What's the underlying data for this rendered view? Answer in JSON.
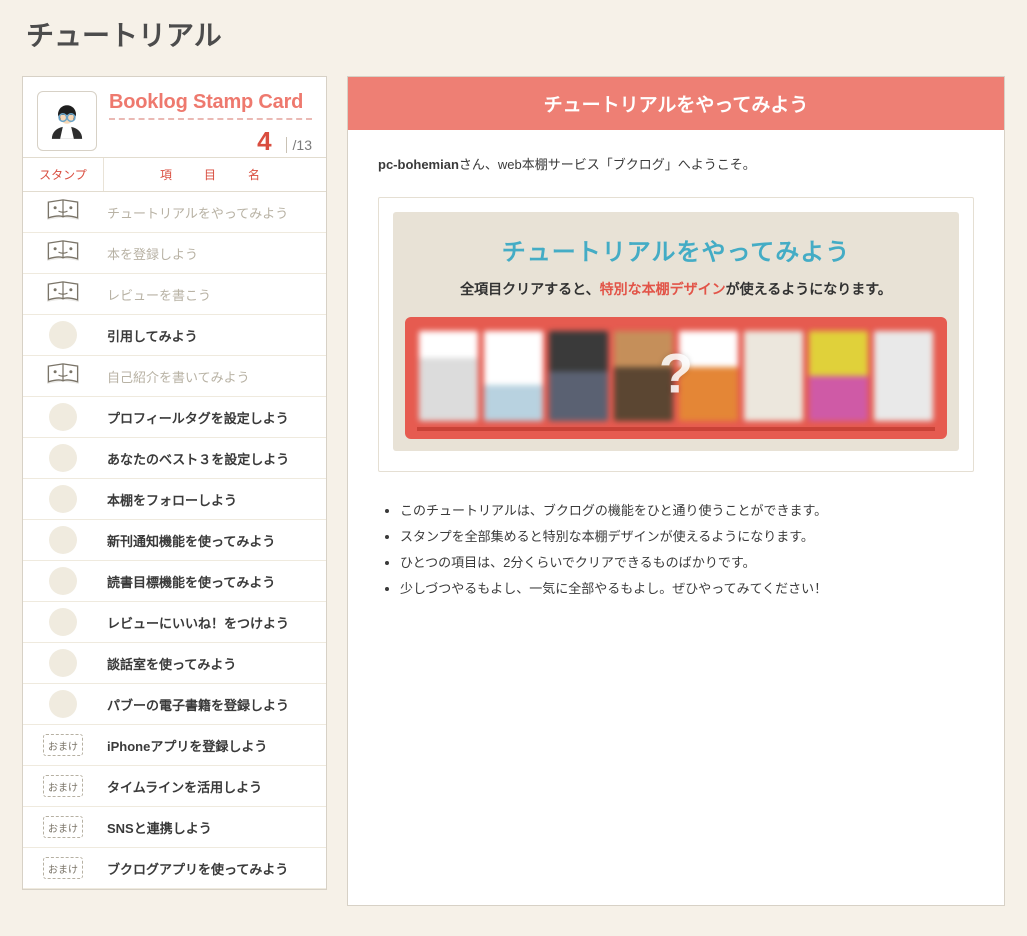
{
  "page_title": "チュートリアル",
  "card": {
    "title": "Booklog Stamp Card",
    "completed": "4",
    "total": "/13",
    "columns": {
      "stamp": "スタンプ",
      "name": "項　目　名"
    },
    "bonus_label": "おまけ",
    "items": [
      {
        "kind": "done",
        "label": "チュートリアルをやってみよう"
      },
      {
        "kind": "done",
        "label": "本を登録しよう"
      },
      {
        "kind": "done",
        "label": "レビューを書こう"
      },
      {
        "kind": "todo",
        "label": "引用してみよう"
      },
      {
        "kind": "done",
        "label": "自己紹介を書いてみよう"
      },
      {
        "kind": "todo",
        "label": "プロフィールタグを設定しよう"
      },
      {
        "kind": "todo",
        "label": "あなたのベスト３を設定しよう"
      },
      {
        "kind": "todo",
        "label": "本棚をフォローしよう"
      },
      {
        "kind": "todo",
        "label": "新刊通知機能を使ってみよう"
      },
      {
        "kind": "todo",
        "label": "読書目標機能を使ってみよう"
      },
      {
        "kind": "todo",
        "label": "レビューにいいね！をつけよう"
      },
      {
        "kind": "todo",
        "label": "談話室を使ってみよう"
      },
      {
        "kind": "todo",
        "label": "パブーの電子書籍を登録しよう"
      },
      {
        "kind": "bonus",
        "label": "iPhoneアプリを登録しよう"
      },
      {
        "kind": "bonus",
        "label": "タイムラインを活用しよう"
      },
      {
        "kind": "bonus",
        "label": "SNSと連携しよう"
      },
      {
        "kind": "bonus",
        "label": "ブクログアプリを使ってみよう"
      }
    ]
  },
  "main": {
    "header": "チュートリアルをやってみよう",
    "welcome_user": "pc-bohemian",
    "welcome_rest": "さん、web本棚サービス「ブクログ」へようこそ。",
    "hero": {
      "title": "チュートリアルをやってみよう",
      "sub_pre": "全項目クリアすると、",
      "sub_accent": "特別な本棚デザイン",
      "sub_post": "が使えるようになります。",
      "question_mark": "?"
    },
    "bullets": [
      "このチュートリアルは、ブクログの機能をひと通り使うことができます。",
      "スタンプを全部集めると特別な本棚デザインが使えるようになります。",
      "ひとつの項目は、2分くらいでクリアできるものばかりです。",
      "少しづつやるもよし、一気に全部やるもよし。ぜひやってみてください！"
    ]
  }
}
